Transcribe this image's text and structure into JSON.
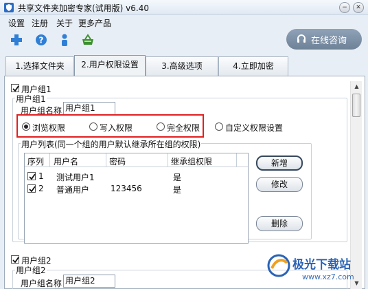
{
  "window": {
    "title": "共享文件夹加密专家(试用版) v6.40",
    "minimize_label": "−",
    "close_label": "✕"
  },
  "menu": {
    "items": [
      "设置",
      "注册",
      "关于",
      "更多产品"
    ]
  },
  "toolbar": {
    "icons": [
      "add-icon",
      "help-icon",
      "user-icon",
      "basket-icon"
    ],
    "consult_label": "在线咨询"
  },
  "tabs": [
    {
      "label": "1.选择文件夹",
      "active": false
    },
    {
      "label": "2.用户权限设置",
      "active": true
    },
    {
      "label": "3.高级选项",
      "active": false
    },
    {
      "label": "4.立即加密",
      "active": false
    }
  ],
  "group1": {
    "checkbox_label": "用户组1",
    "checked": true,
    "frame_title": "用户组1",
    "name_label": "用户组名称",
    "name_value": "用户组1",
    "permissions": [
      {
        "label": "浏览权限",
        "selected": true
      },
      {
        "label": "写入权限",
        "selected": false
      },
      {
        "label": "完全权限",
        "selected": false
      },
      {
        "label": "自定义权限设置",
        "selected": false
      }
    ],
    "user_list_title": "用户列表(同一个组的用户默认继承所在组的权限)",
    "columns": [
      "序列",
      "用户名",
      "密码",
      "继承组权限"
    ],
    "rows": [
      {
        "index": "1",
        "checked": true,
        "username": "测试用户1",
        "password": "",
        "inherit": "是"
      },
      {
        "index": "2",
        "checked": true,
        "username": "普通用户",
        "password": "123456",
        "inherit": "是"
      }
    ],
    "buttons": {
      "add": "新增",
      "edit": "修改",
      "delete": "删除"
    }
  },
  "group2": {
    "checkbox_label": "用户组2",
    "checked": true,
    "frame_title": "用户组2",
    "name_label": "用户组名称",
    "name_value": "用户组2"
  },
  "watermark": {
    "brand": "极光下载站",
    "url": "www.xz7.com"
  },
  "colors": {
    "accent_blue": "#2b6cc4",
    "highlight_red": "#e02020",
    "consult_bg": "#7b8ea5"
  }
}
